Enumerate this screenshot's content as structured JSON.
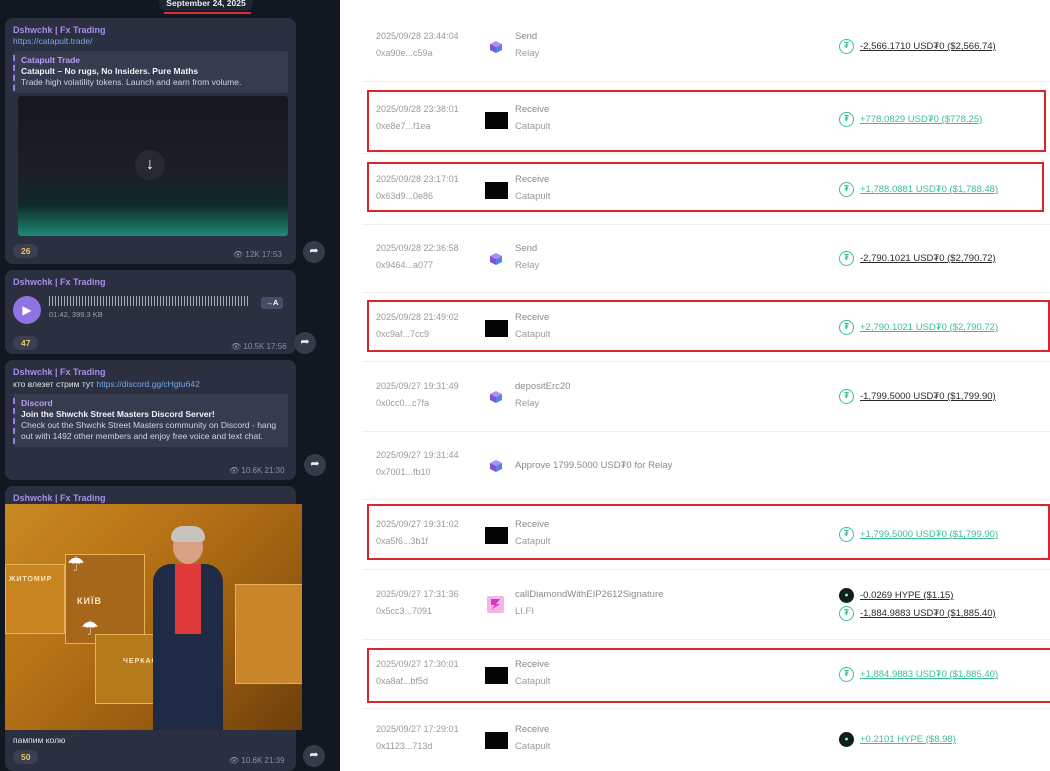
{
  "colors": {
    "chat_bg": "#131722",
    "bubble_bg": "#2b3040",
    "sender": "#a78ee8",
    "positive_amount": "#3bbf8f",
    "negative_amount": "#2a2a2a",
    "highlight_border": "#d7252c"
  },
  "chat": {
    "date_badge": "September 24, 2025",
    "messages": [
      {
        "sender": "Dshwchk | Fx Trading",
        "link": "https://catapult.trade/",
        "preview_title": "Catapult Trade",
        "preview_headline": "Catapult – No rugs, No Insiders. Pure Maths",
        "preview_text": "Trade high volatility tokens. Launch and earn from volume.",
        "reaction": "26",
        "views": "12K",
        "time": "17:53",
        "download_icon": "arrow-down-icon",
        "forward_icon": "share-icon"
      },
      {
        "sender": "Dshwchk | Fx Trading",
        "voice_meta": "01:42, 399.3 KB",
        "to_text_label": "→A",
        "reaction": "47",
        "views": "10.5K",
        "time": "17:56",
        "play_icon": "play-icon"
      },
      {
        "sender": "Dshwchk | Fx Trading",
        "text_prefix": "кто влезет стрим тут ",
        "link": "https://discord.gg/cHgtu642",
        "preview_title": "Discord",
        "preview_headline": "Join the Shwchk Street Masters Discord Server!",
        "preview_text": "Check out the Shwchk Street Masters community on Discord - hang out with 1492 other members and enjoy free voice and text chat.",
        "views": "10.6K",
        "time": "21:30"
      },
      {
        "sender": "Dshwchk | Fx Trading",
        "map_labels": [
          "КИЇВ",
          "ЧЕРКАСИ",
          "ЖИТОМИР"
        ],
        "caption": "пампим колю",
        "reaction": "50",
        "views": "10.6K",
        "time": "21:39"
      }
    ]
  },
  "transactions": [
    {
      "ts": "2025/09/28 23:44:04",
      "hash": "0xa90e...c59a",
      "icon": "relay-cube-icon",
      "action": "Send",
      "sub": "Relay",
      "amounts": [
        {
          "icon": "usdt0-icon",
          "text": "-2,566.1710 USD₮0 ($2,566.74)",
          "sign": "neg"
        }
      ],
      "highlighted": false
    },
    {
      "ts": "2025/09/28 23:38:01",
      "hash": "0xe8e7...f1ea",
      "icon": "catapult-logo-icon",
      "action": "Receive",
      "sub": "Catapult",
      "amounts": [
        {
          "icon": "usdt0-icon",
          "text": "+778.0829 USD₮0 ($778.25)",
          "sign": "pos"
        }
      ],
      "highlighted": true
    },
    {
      "ts": "2025/09/28 23:17:01",
      "hash": "0x63d9...0e86",
      "icon": "catapult-logo-icon",
      "action": "Receive",
      "sub": "Catapult",
      "amounts": [
        {
          "icon": "usdt0-icon",
          "text": "+1,788.0881 USD₮0 ($1,788.48)",
          "sign": "pos"
        }
      ],
      "highlighted": true
    },
    {
      "ts": "2025/09/28 22:36:58",
      "hash": "0x9464...a077",
      "icon": "relay-cube-icon",
      "action": "Send",
      "sub": "Relay",
      "amounts": [
        {
          "icon": "usdt0-icon",
          "text": "-2,790.1021 USD₮0 ($2,790.72)",
          "sign": "neg"
        }
      ],
      "highlighted": false
    },
    {
      "ts": "2025/09/28 21:49:02",
      "hash": "0xc9af...7cc9",
      "icon": "catapult-logo-icon",
      "action": "Receive",
      "sub": "Catapult",
      "amounts": [
        {
          "icon": "usdt0-icon",
          "text": "+2,790.1021 USD₮0 ($2,790.72)",
          "sign": "pos"
        }
      ],
      "highlighted": true
    },
    {
      "ts": "2025/09/27 19:31:49",
      "hash": "0x0cc0...c7fa",
      "icon": "relay-cube-icon",
      "action": "depositErc20",
      "sub": "Relay",
      "amounts": [
        {
          "icon": "usdt0-icon",
          "text": "-1,799.5000 USD₮0 ($1,799.90)",
          "sign": "neg"
        }
      ],
      "highlighted": false
    },
    {
      "ts": "2025/09/27 19:31:44",
      "hash": "0x7001...fb10",
      "icon": "relay-cube-icon",
      "action": "Approve 1799.5000 USD₮0 for Relay",
      "sub": "",
      "amounts": [],
      "highlighted": false
    },
    {
      "ts": "2025/09/27 19:31:02",
      "hash": "0xa5f6...3b1f",
      "icon": "catapult-logo-icon",
      "action": "Receive",
      "sub": "Catapult",
      "amounts": [
        {
          "icon": "usdt0-icon",
          "text": "+1,799.5000 USD₮0 ($1,799.90)",
          "sign": "pos"
        }
      ],
      "highlighted": true
    },
    {
      "ts": "2025/09/27 17:31:36",
      "hash": "0x5cc3...7091",
      "icon": "lifi-logo-icon",
      "action": "callDiamondWithEIP2612Signature",
      "sub": "LI.FI",
      "amounts": [
        {
          "icon": "hype-icon",
          "text": "-0.0269 HYPE ($1.15)",
          "sign": "neg"
        },
        {
          "icon": "usdt0-icon",
          "text": "-1,884.9883 USD₮0 ($1,885.40)",
          "sign": "neg"
        }
      ],
      "highlighted": false
    },
    {
      "ts": "2025/09/27 17:30:01",
      "hash": "0xa8af...bf5d",
      "icon": "catapult-logo-icon",
      "action": "Receive",
      "sub": "Catapult",
      "amounts": [
        {
          "icon": "usdt0-icon",
          "text": "+1,884.9883 USD₮0 ($1,885.40)",
          "sign": "pos"
        }
      ],
      "highlighted": true
    },
    {
      "ts": "2025/09/27 17:29:01",
      "hash": "0x1123...713d",
      "icon": "catapult-logo-icon",
      "action": "Receive",
      "sub": "Catapult",
      "amounts": [
        {
          "icon": "hype-icon",
          "text": "+0.2101 HYPE ($8.98)",
          "sign": "pos"
        }
      ],
      "highlighted": false
    }
  ]
}
